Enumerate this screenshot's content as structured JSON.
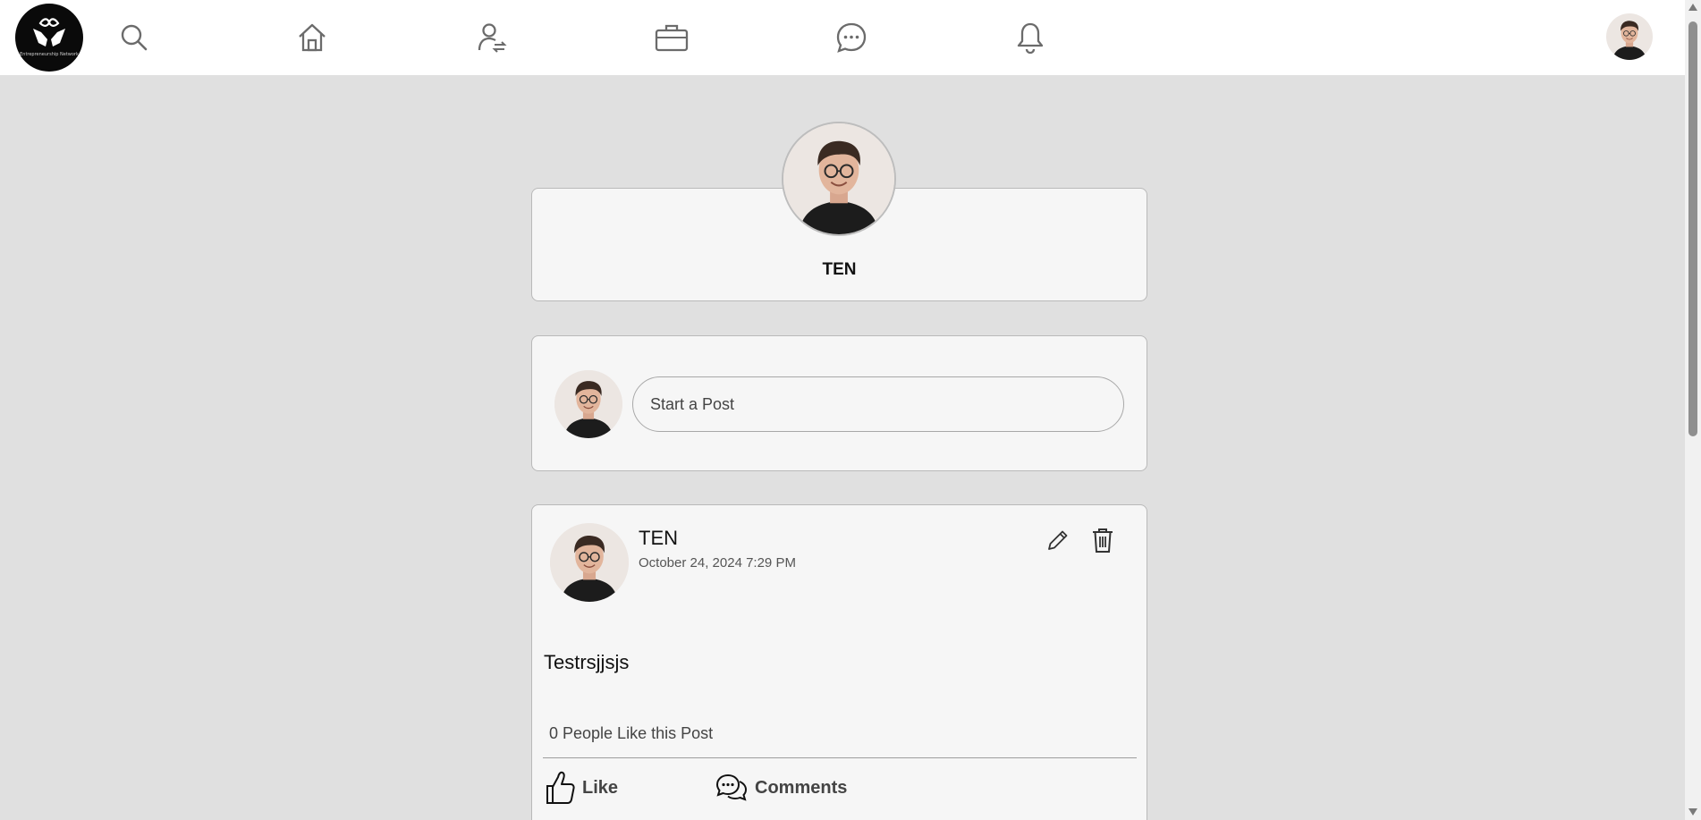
{
  "nav": {
    "logo_text": "Entrepreneurship Network",
    "icons": [
      "search-icon",
      "home-icon",
      "network-icon",
      "jobs-icon",
      "messages-icon",
      "notifications-icon"
    ]
  },
  "profile": {
    "name": "TEN"
  },
  "compose": {
    "placeholder": "Start a Post"
  },
  "post": {
    "author": "TEN",
    "timestamp": "October 24, 2024 7:29 PM",
    "body": "Testrsjjsjs",
    "likes_text": "0 People Like this Post",
    "like_label": "Like",
    "comments_label": "Comments"
  },
  "colors": {
    "page_bg": "#e0e0e0",
    "card_bg": "#f6f6f6",
    "topbar_bg": "#ffffff",
    "icon": "#6b6b6b"
  }
}
